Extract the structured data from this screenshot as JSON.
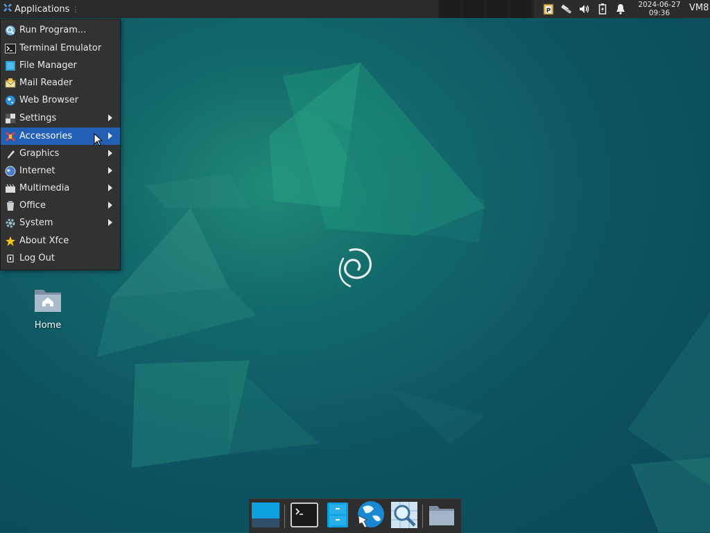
{
  "top_panel": {
    "applications_label": "Applications",
    "separator": "⋮",
    "clock": {
      "date": "2024-06-27",
      "time": "09:36"
    },
    "user": "VM8"
  },
  "menu": {
    "items": [
      {
        "label": "Run Program...",
        "icon": "run-program-icon",
        "submenu": false
      },
      {
        "label": "Terminal Emulator",
        "icon": "terminal-icon",
        "submenu": false
      },
      {
        "label": "File Manager",
        "icon": "file-manager-icon",
        "submenu": false
      },
      {
        "label": "Mail Reader",
        "icon": "mail-icon",
        "submenu": false
      },
      {
        "label": "Web Browser",
        "icon": "web-browser-icon",
        "submenu": false
      },
      {
        "label": "Settings",
        "icon": "settings-icon",
        "submenu": true
      },
      {
        "label": "Accessories",
        "icon": "accessories-icon",
        "submenu": true,
        "active": true
      },
      {
        "label": "Graphics",
        "icon": "graphics-icon",
        "submenu": true
      },
      {
        "label": "Internet",
        "icon": "internet-icon",
        "submenu": true
      },
      {
        "label": "Multimedia",
        "icon": "multimedia-icon",
        "submenu": true
      },
      {
        "label": "Office",
        "icon": "office-icon",
        "submenu": true
      },
      {
        "label": "System",
        "icon": "system-icon",
        "submenu": true
      },
      {
        "label": "About Xfce",
        "icon": "star-icon",
        "submenu": false
      },
      {
        "label": "Log Out",
        "icon": "log-out-icon",
        "submenu": false
      }
    ]
  },
  "desktop": {
    "home_label": "Home"
  },
  "dock": {
    "items": [
      "show-desktop-icon",
      "terminal-icon",
      "file-manager-icon",
      "web-browser-icon",
      "app-finder-icon",
      "folder-icon"
    ]
  },
  "colors": {
    "panel": "#2b2b2b",
    "menu_bg": "#323232",
    "menu_highlight": "#2160b4",
    "desktop_teal": "#0d5563"
  }
}
